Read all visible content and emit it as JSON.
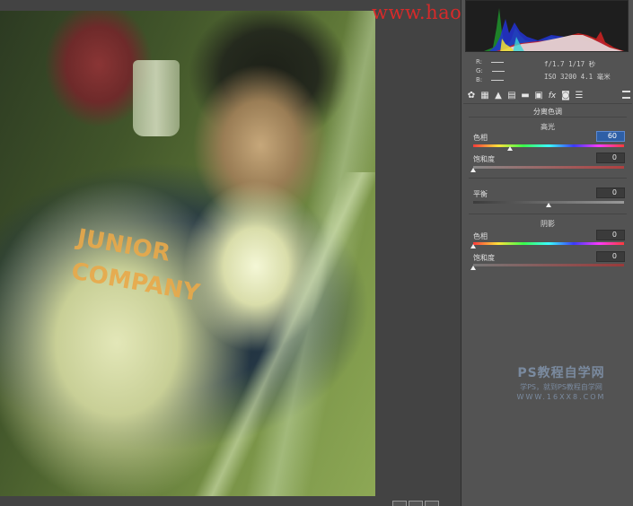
{
  "watermark": "www.haoyicianshe.com",
  "ps_watermark": {
    "title": "PS教程自学网",
    "tagline": "学PS，就到PS教程自学网",
    "url": "WWW.16XX8.COM"
  },
  "photo": {
    "shirt_text": "JUNIOR COMPANY"
  },
  "info": {
    "r_label": "R:",
    "g_label": "G:",
    "b_label": "B:",
    "aperture_shutter": "f/1.7   1/17 秒",
    "iso_focal": "ISO 3200   4.1 毫米"
  },
  "toolbar": {
    "icons": [
      "aperture-icon",
      "grid-icon",
      "mountain-icon",
      "tone-curve-icon",
      "split-tone-icon",
      "lens-icon",
      "fx-icon",
      "camera-calibration-icon",
      "presets-icon"
    ]
  },
  "split_toning": {
    "title": "分离色调",
    "highlights": {
      "label": "高光",
      "hue_label": "色相",
      "hue_value": "60",
      "saturation_label": "饱和度",
      "saturation_value": "0"
    },
    "balance": {
      "label": "平衡",
      "value": "0"
    },
    "shadows": {
      "label": "阴影",
      "hue_label": "色相",
      "hue_value": "0",
      "saturation_label": "饱和度",
      "saturation_value": "0"
    }
  },
  "colors": {
    "panel_bg": "#535353",
    "accent": "#2e5fa6",
    "watermark": "#d62a2a"
  }
}
